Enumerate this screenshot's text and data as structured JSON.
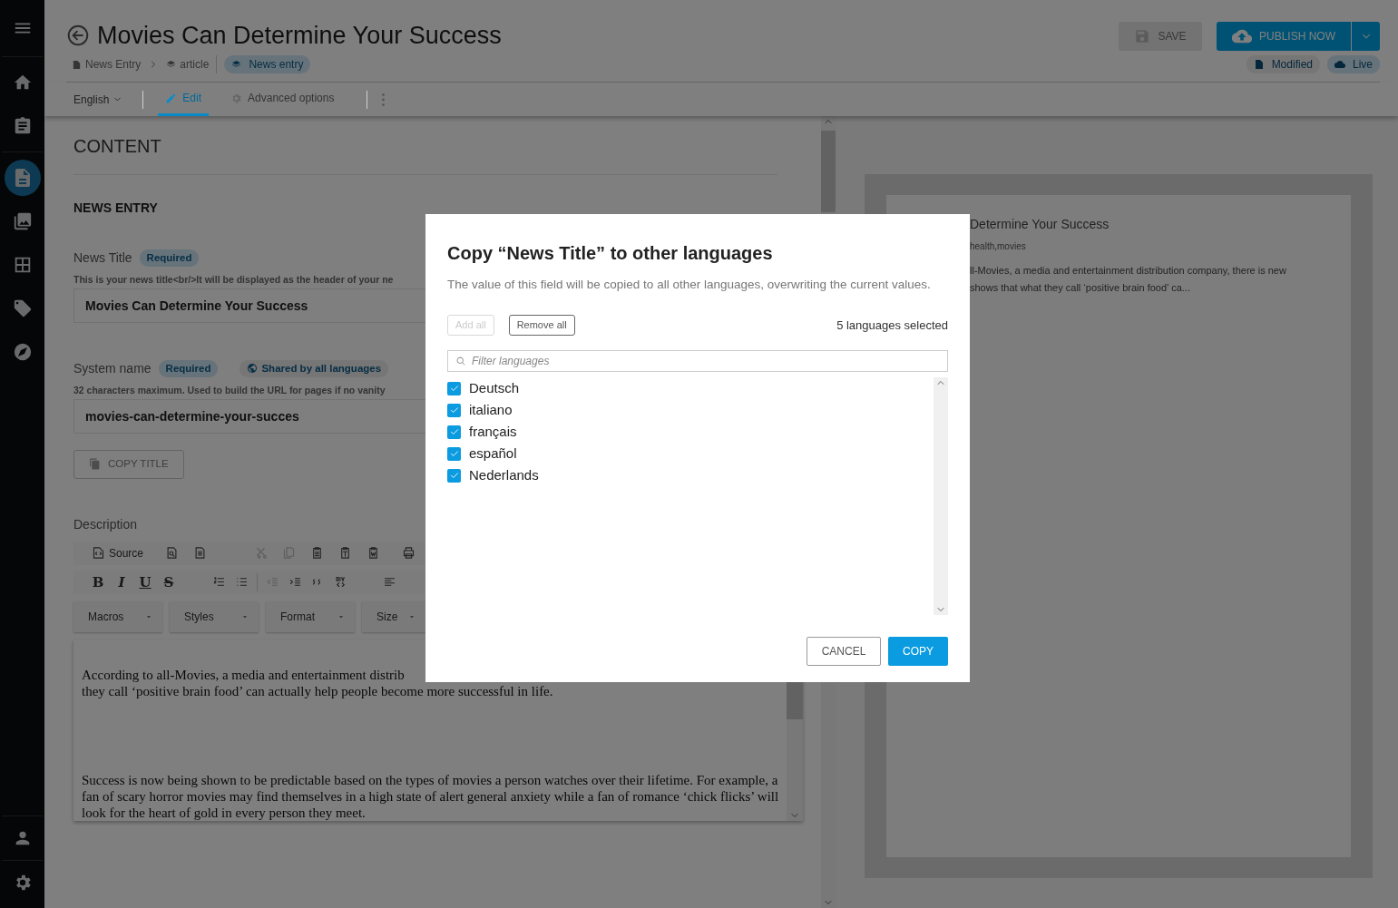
{
  "sidebar": {
    "items": [
      {
        "selected": false
      },
      {
        "selected": false
      },
      {
        "selected": false
      },
      {
        "selected": true
      },
      {
        "selected": false
      },
      {
        "selected": false
      },
      {
        "selected": false
      },
      {
        "selected": false
      },
      {
        "selected": false
      },
      {
        "selected": false
      }
    ]
  },
  "header": {
    "title": "Movies Can Determine Your Success",
    "breadcrumb": [
      {
        "label": "News Entry"
      },
      {
        "label": "article"
      }
    ],
    "type_badge": "News entry",
    "save_button": {
      "label": "SAVE",
      "disabled": true
    },
    "publish_button": {
      "label": "PUBLISH NOW"
    },
    "status_badges": [
      {
        "label": "Modified",
        "kind": "modified"
      },
      {
        "label": "Live",
        "kind": "live"
      }
    ]
  },
  "toolbar": {
    "language": "English",
    "tabs": [
      {
        "label": "Edit",
        "selected": true
      },
      {
        "label": "Advanced options",
        "selected": false
      }
    ]
  },
  "content": {
    "heading": "CONTENT",
    "section": "NEWS ENTRY",
    "fields": [
      {
        "label": "News Title",
        "badges": [
          {
            "label": "Required",
            "kind": "required"
          }
        ],
        "help": "This is your news title<br/>It will be displayed as the header of your ne",
        "value": "Movies Can Determine Your Success"
      },
      {
        "label": "System name",
        "badges": [
          {
            "label": "Required",
            "kind": "required"
          },
          {
            "label": "Shared by all languages",
            "kind": "shared"
          }
        ],
        "help": "32 characters maximum. Used to build the URL for pages if no vanity",
        "value": "movies-can-determine-your-succes"
      }
    ],
    "copy_button": {
      "label": "COPY TITLE",
      "disabled": true
    }
  },
  "description": {
    "label": "Description",
    "source_button": "Source",
    "format_buttons": [
      "B",
      "I",
      "U",
      "S"
    ],
    "dropdowns": [
      "Macros",
      "Styles",
      "Format",
      "Size"
    ],
    "paragraphs": [
      {
        "lines": [
          "According to all-Movies, a media and entertainment distrib",
          "they call ‘positive brain food’ can actually help people become more successful in life."
        ]
      },
      {
        "lines": [
          "Success is now being shown to be predictable based on the types of movies a person watches over their lifetime. For example, a fan of scary horror movies may find themselves in a high state of alert general anxiety while a fan of romance ‘chick flicks’ will look for the heart of gold in every person they meet."
        ]
      }
    ]
  },
  "preview": {
    "title": "Determine Your Success",
    "tags": "health,movies",
    "excerpt": [
      "ll-Movies, a media and entertainment distribution company, there is new",
      "shows that what they call ‘positive brain food’ ca..."
    ]
  },
  "modal": {
    "title": "Copy “News Title” to other languages",
    "text": "The value of this field will be copied to all other languages, overwriting the current values.",
    "add_all": {
      "label": "Add all",
      "disabled": true
    },
    "remove_all": {
      "label": "Remove all",
      "disabled": false
    },
    "count": "5 languages selected",
    "filter_placeholder": "Filter languages",
    "languages": [
      {
        "name": "Deutsch",
        "checked": true
      },
      {
        "name": "italiano",
        "checked": true
      },
      {
        "name": "français",
        "checked": true
      },
      {
        "name": "español",
        "checked": true
      },
      {
        "name": "Nederlands",
        "checked": true
      }
    ],
    "cancel": "CANCEL",
    "copy": "COPY"
  }
}
